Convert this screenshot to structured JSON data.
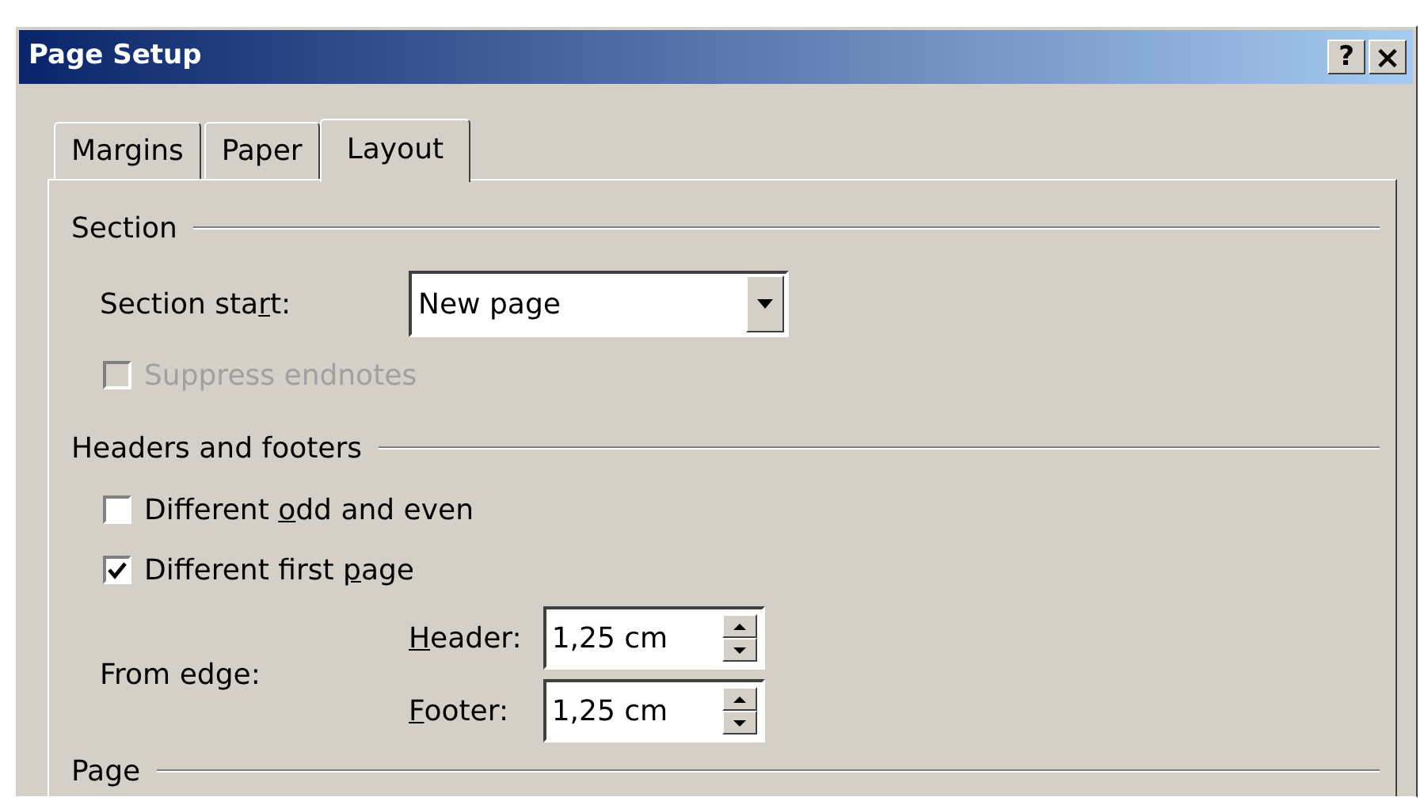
{
  "window": {
    "title": "Page Setup",
    "buttons": [
      {
        "kind": "help",
        "label": "?"
      },
      {
        "kind": "close",
        "label": "×"
      }
    ]
  },
  "tabs": [
    {
      "label": "Margins",
      "selected": false
    },
    {
      "label": "Paper",
      "selected": false
    },
    {
      "label": "Layout",
      "selected": true
    }
  ],
  "section": {
    "title": "Section",
    "section_start": {
      "label": {
        "before": "Section sta",
        "key": "r",
        "after": "t:"
      },
      "value": "New page"
    },
    "suppress_endnotes": {
      "label": {
        "before": "Suppress endnotes"
      },
      "checked": false,
      "disabled": true
    }
  },
  "headers_and_footers": {
    "title": "Headers and footers",
    "options": [
      {
        "label": {
          "before": "Different ",
          "key": "o",
          "after": "dd and even"
        },
        "checked": false,
        "disabled": false
      },
      {
        "label": {
          "before": "Different first ",
          "key": "p",
          "after": "age"
        },
        "checked": true,
        "disabled": false
      }
    ],
    "from_edge": {
      "label": "From edge:",
      "fields": [
        {
          "label": {
            "key": "H",
            "after": "eader:"
          },
          "value": "1,25 cm"
        },
        {
          "label": {
            "key": "F",
            "after": "ooter:"
          },
          "value": "1,25 cm"
        }
      ]
    }
  },
  "page": {
    "title": "Page"
  }
}
